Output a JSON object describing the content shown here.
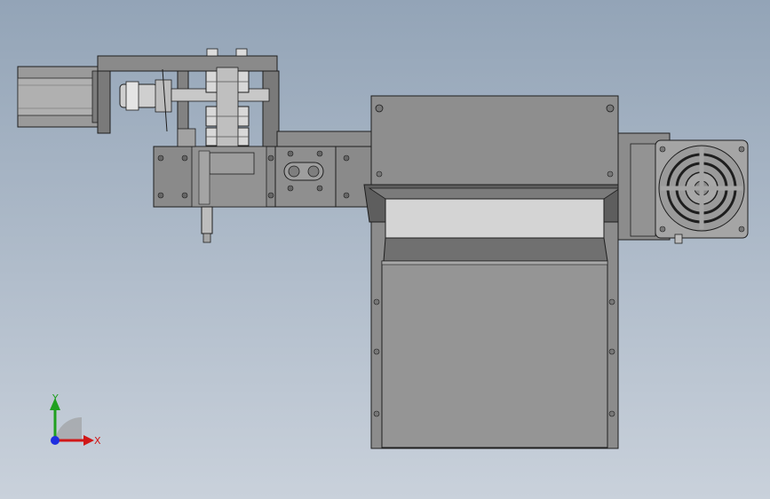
{
  "viewport": {
    "background_top": "#93a4b7",
    "background_bottom": "#c9d1db"
  },
  "model": {
    "part_fill": "#8e8e8e",
    "part_dark": "#6e6e6e",
    "part_light": "#a8a8a8",
    "edge_color": "#1e1e1e",
    "glass_fill": "#d4d4d4"
  },
  "triad": {
    "x_label": "X",
    "y_label": "Y",
    "x_color": "#d01818",
    "y_color": "#20a020",
    "z_color": "#1e2ee0"
  }
}
